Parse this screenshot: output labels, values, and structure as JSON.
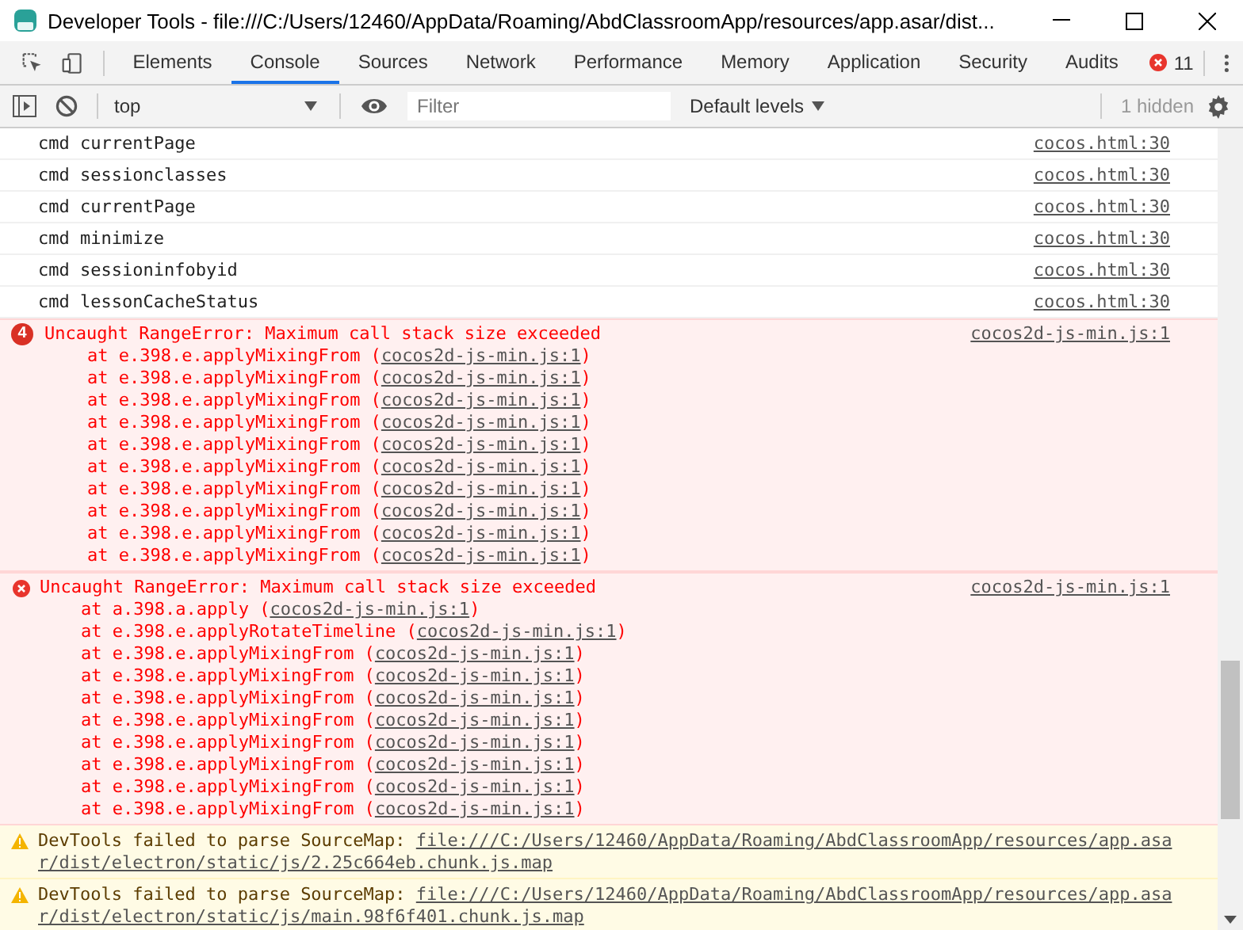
{
  "window": {
    "title": "Developer Tools - file:///C:/Users/12460/AppData/Roaming/AbdClassroomApp/resources/app.asar/dist..."
  },
  "tabs": [
    {
      "label": "Elements",
      "selected": false
    },
    {
      "label": "Console",
      "selected": true
    },
    {
      "label": "Sources",
      "selected": false
    },
    {
      "label": "Network",
      "selected": false
    },
    {
      "label": "Performance",
      "selected": false
    },
    {
      "label": "Memory",
      "selected": false
    },
    {
      "label": "Application",
      "selected": false
    },
    {
      "label": "Security",
      "selected": false
    },
    {
      "label": "Audits",
      "selected": false
    }
  ],
  "error_count": "11",
  "toolbar": {
    "context": "top",
    "filter": {
      "placeholder": "Filter"
    },
    "levels": "Default levels",
    "hidden": "1 hidden"
  },
  "messages": [
    {
      "kind": "log",
      "text": "cmd currentPage",
      "source": "cocos.html:30"
    },
    {
      "kind": "log",
      "text": "cmd sessionclasses",
      "source": "cocos.html:30"
    },
    {
      "kind": "log",
      "text": "cmd currentPage",
      "source": "cocos.html:30"
    },
    {
      "kind": "log",
      "text": "cmd minimize",
      "source": "cocos.html:30"
    },
    {
      "kind": "log",
      "text": "cmd sessioninfobyid",
      "source": "cocos.html:30"
    },
    {
      "kind": "log",
      "text": "cmd lessonCacheStatus",
      "source": "cocos.html:30"
    },
    {
      "kind": "error",
      "repeat_count": "4",
      "text": "Uncaught RangeError: Maximum call stack size exceeded",
      "source": "cocos2d-js-min.js:1",
      "stack": [
        {
          "call": "at e.398.e.applyMixingFrom (",
          "location": "cocos2d-js-min.js:1",
          "close": ")"
        },
        {
          "call": "at e.398.e.applyMixingFrom (",
          "location": "cocos2d-js-min.js:1",
          "close": ")"
        },
        {
          "call": "at e.398.e.applyMixingFrom (",
          "location": "cocos2d-js-min.js:1",
          "close": ")"
        },
        {
          "call": "at e.398.e.applyMixingFrom (",
          "location": "cocos2d-js-min.js:1",
          "close": ")"
        },
        {
          "call": "at e.398.e.applyMixingFrom (",
          "location": "cocos2d-js-min.js:1",
          "close": ")"
        },
        {
          "call": "at e.398.e.applyMixingFrom (",
          "location": "cocos2d-js-min.js:1",
          "close": ")"
        },
        {
          "call": "at e.398.e.applyMixingFrom (",
          "location": "cocos2d-js-min.js:1",
          "close": ")"
        },
        {
          "call": "at e.398.e.applyMixingFrom (",
          "location": "cocos2d-js-min.js:1",
          "close": ")"
        },
        {
          "call": "at e.398.e.applyMixingFrom (",
          "location": "cocos2d-js-min.js:1",
          "close": ")"
        },
        {
          "call": "at e.398.e.applyMixingFrom (",
          "location": "cocos2d-js-min.js:1",
          "close": ")"
        }
      ]
    },
    {
      "kind": "error",
      "text": "Uncaught RangeError: Maximum call stack size exceeded",
      "source": "cocos2d-js-min.js:1",
      "stack": [
        {
          "call": "at a.398.a.apply (",
          "location": "cocos2d-js-min.js:1",
          "close": ")"
        },
        {
          "call": "at e.398.e.applyRotateTimeline (",
          "location": "cocos2d-js-min.js:1",
          "close": ")"
        },
        {
          "call": "at e.398.e.applyMixingFrom (",
          "location": "cocos2d-js-min.js:1",
          "close": ")"
        },
        {
          "call": "at e.398.e.applyMixingFrom (",
          "location": "cocos2d-js-min.js:1",
          "close": ")"
        },
        {
          "call": "at e.398.e.applyMixingFrom (",
          "location": "cocos2d-js-min.js:1",
          "close": ")"
        },
        {
          "call": "at e.398.e.applyMixingFrom (",
          "location": "cocos2d-js-min.js:1",
          "close": ")"
        },
        {
          "call": "at e.398.e.applyMixingFrom (",
          "location": "cocos2d-js-min.js:1",
          "close": ")"
        },
        {
          "call": "at e.398.e.applyMixingFrom (",
          "location": "cocos2d-js-min.js:1",
          "close": ")"
        },
        {
          "call": "at e.398.e.applyMixingFrom (",
          "location": "cocos2d-js-min.js:1",
          "close": ")"
        },
        {
          "call": "at e.398.e.applyMixingFrom (",
          "location": "cocos2d-js-min.js:1",
          "close": ")"
        }
      ]
    },
    {
      "kind": "warning",
      "text": "DevTools failed to parse SourceMap:",
      "url": "file:///C:/Users/12460/AppData/Roaming/AbdClassroomApp/resources/app.asar/dist/electron/static/js/2.25c664eb.chunk.js.map"
    },
    {
      "kind": "warning",
      "text": "DevTools failed to parse SourceMap:",
      "url": "file:///C:/Users/12460/AppData/Roaming/AbdClassroomApp/resources/app.asar/dist/electron/static/js/main.98f6f401.chunk.js.map"
    }
  ]
}
